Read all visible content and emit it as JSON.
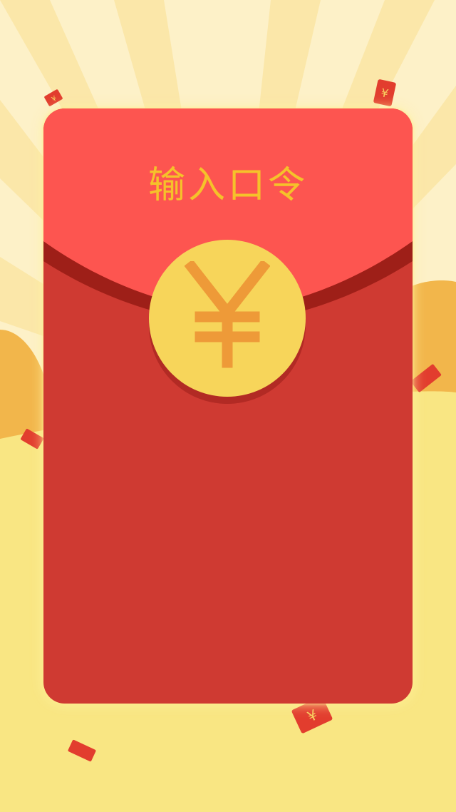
{
  "envelope": {
    "title": "输入口令",
    "coin_icon": "yuan-icon"
  },
  "decorations": {
    "mini_packet_icon": "yuan-icon",
    "mini_packet_symbol": "¥"
  },
  "colors": {
    "envelope_body": "#cf3a32",
    "envelope_flap": "#fd5550",
    "flap_shadow": "#9e1f18",
    "title_text": "#f5c22a",
    "coin": "#f7d55a",
    "coin_symbol": "#ee9a38",
    "background_rays": "#fdf1c8",
    "background_ground": "#f9e683",
    "background_hills": "#f2b64b"
  }
}
